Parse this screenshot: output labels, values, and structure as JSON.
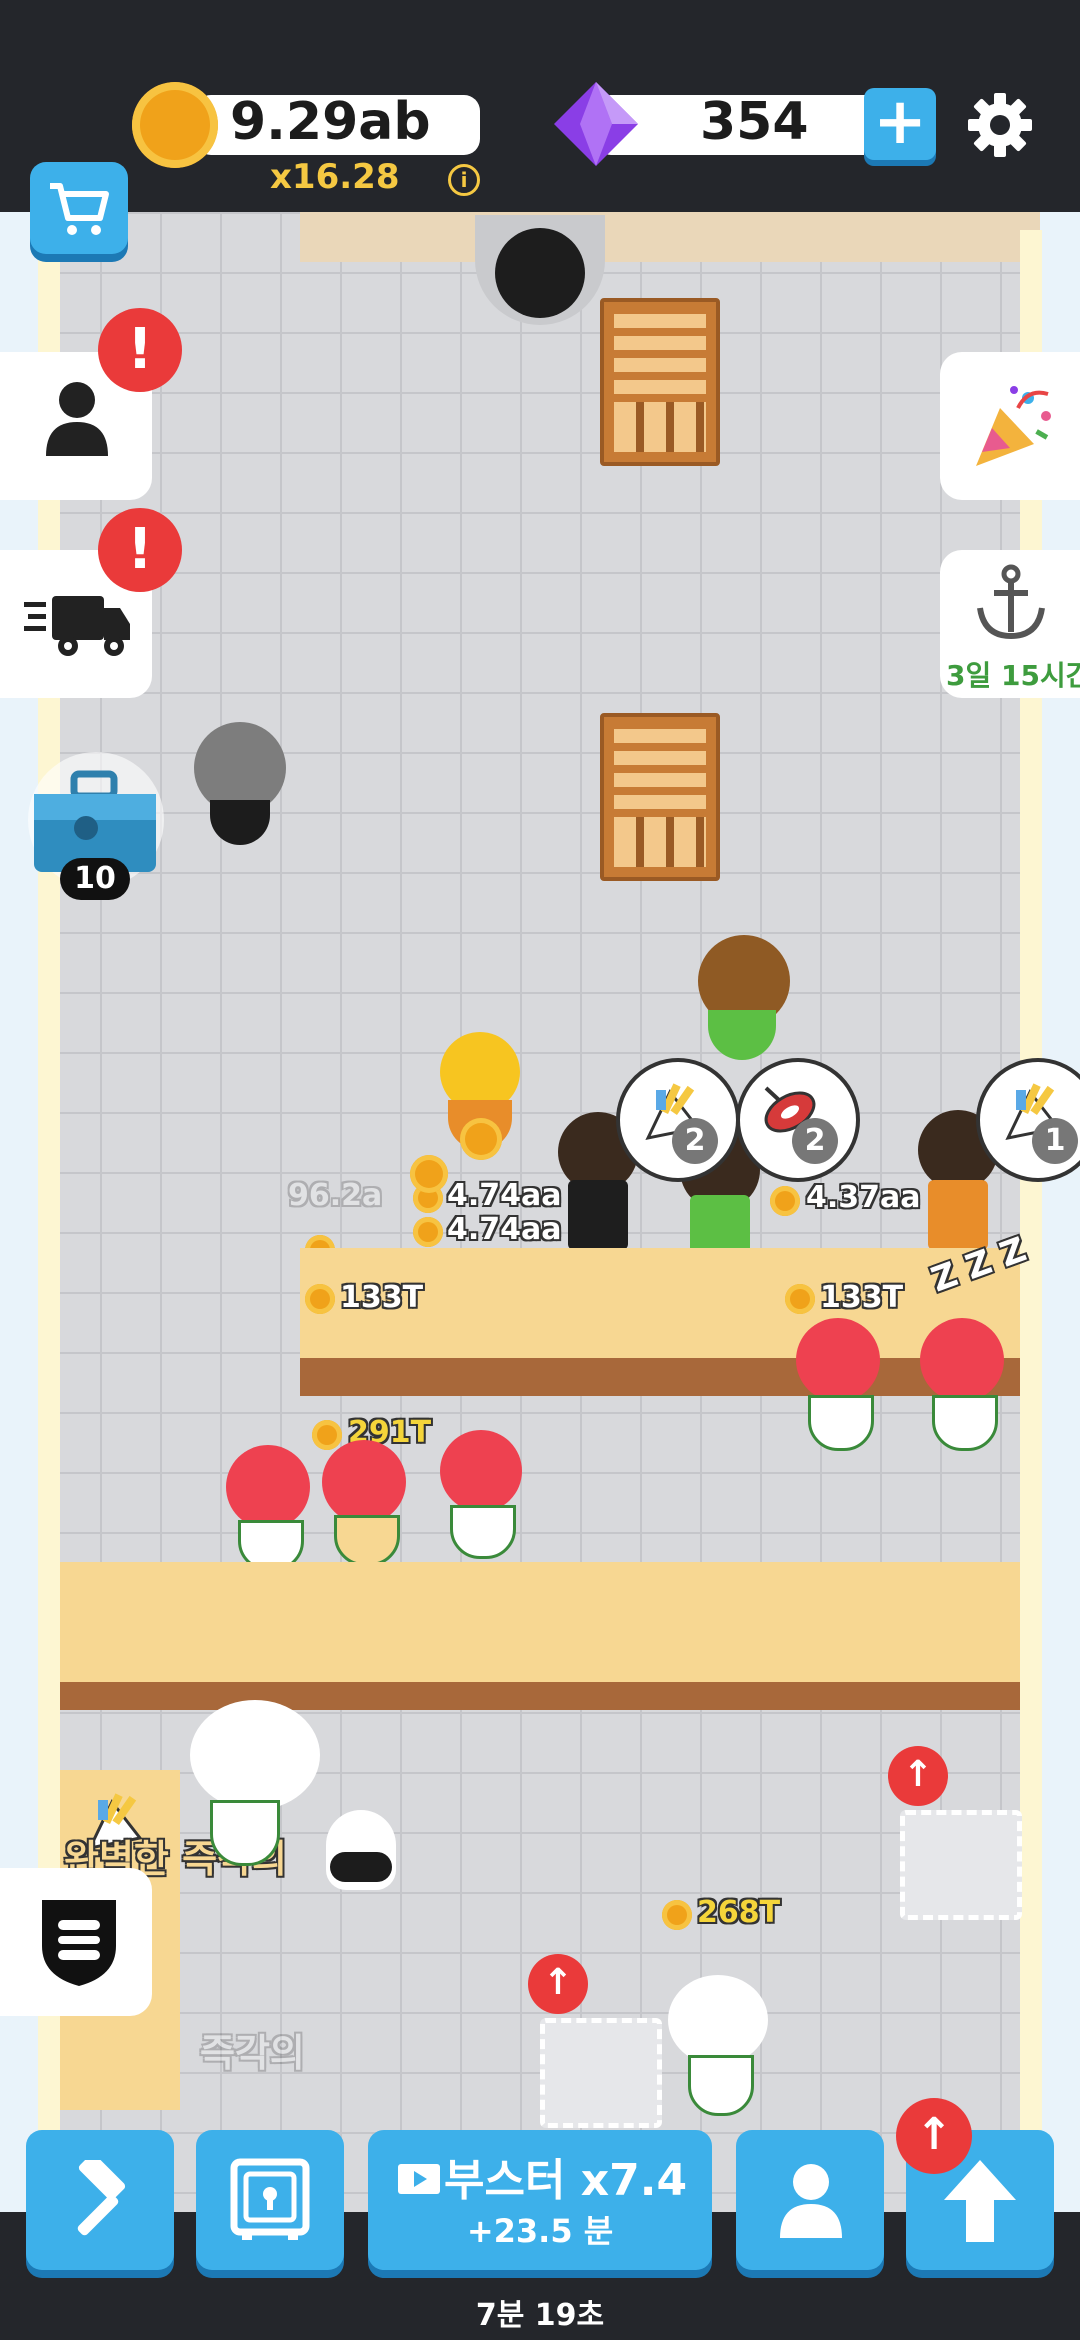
{
  "topbar": {
    "coins": "9.29ab",
    "multiplier": "x16.28",
    "info_icon": "i",
    "gems": "354",
    "add_icon": "+"
  },
  "side": {
    "alert_symbol": "!",
    "toolbox_count": "10",
    "event_timer": "3일 15시간"
  },
  "floor_labels": {
    "pickup_1": "4.74aa",
    "pickup_2": "4.74aa",
    "pickup_faded": "96.2a",
    "pickup_3": "4.37aa",
    "counter_left": "133T",
    "counter_right": "133T",
    "chef_group": "291T",
    "kitchen_chef": "268T",
    "sleep": "Z Z Z",
    "faded_text_1": "완벽한 즉각의",
    "faded_text_2": "즉각의"
  },
  "orders": [
    {
      "item": "fries-icon",
      "count": "2"
    },
    {
      "item": "meat-icon",
      "count": "2"
    },
    {
      "item": "fries-icon",
      "count": "1"
    }
  ],
  "booster": {
    "label": "부스터 x7.4",
    "sub": "+23.5 분"
  },
  "timer": "7분 19초",
  "colors": {
    "accent": "#3db0ea",
    "alert": "#ea3a3a",
    "gold": "#f5c842",
    "gem": "#8a3ee6"
  }
}
